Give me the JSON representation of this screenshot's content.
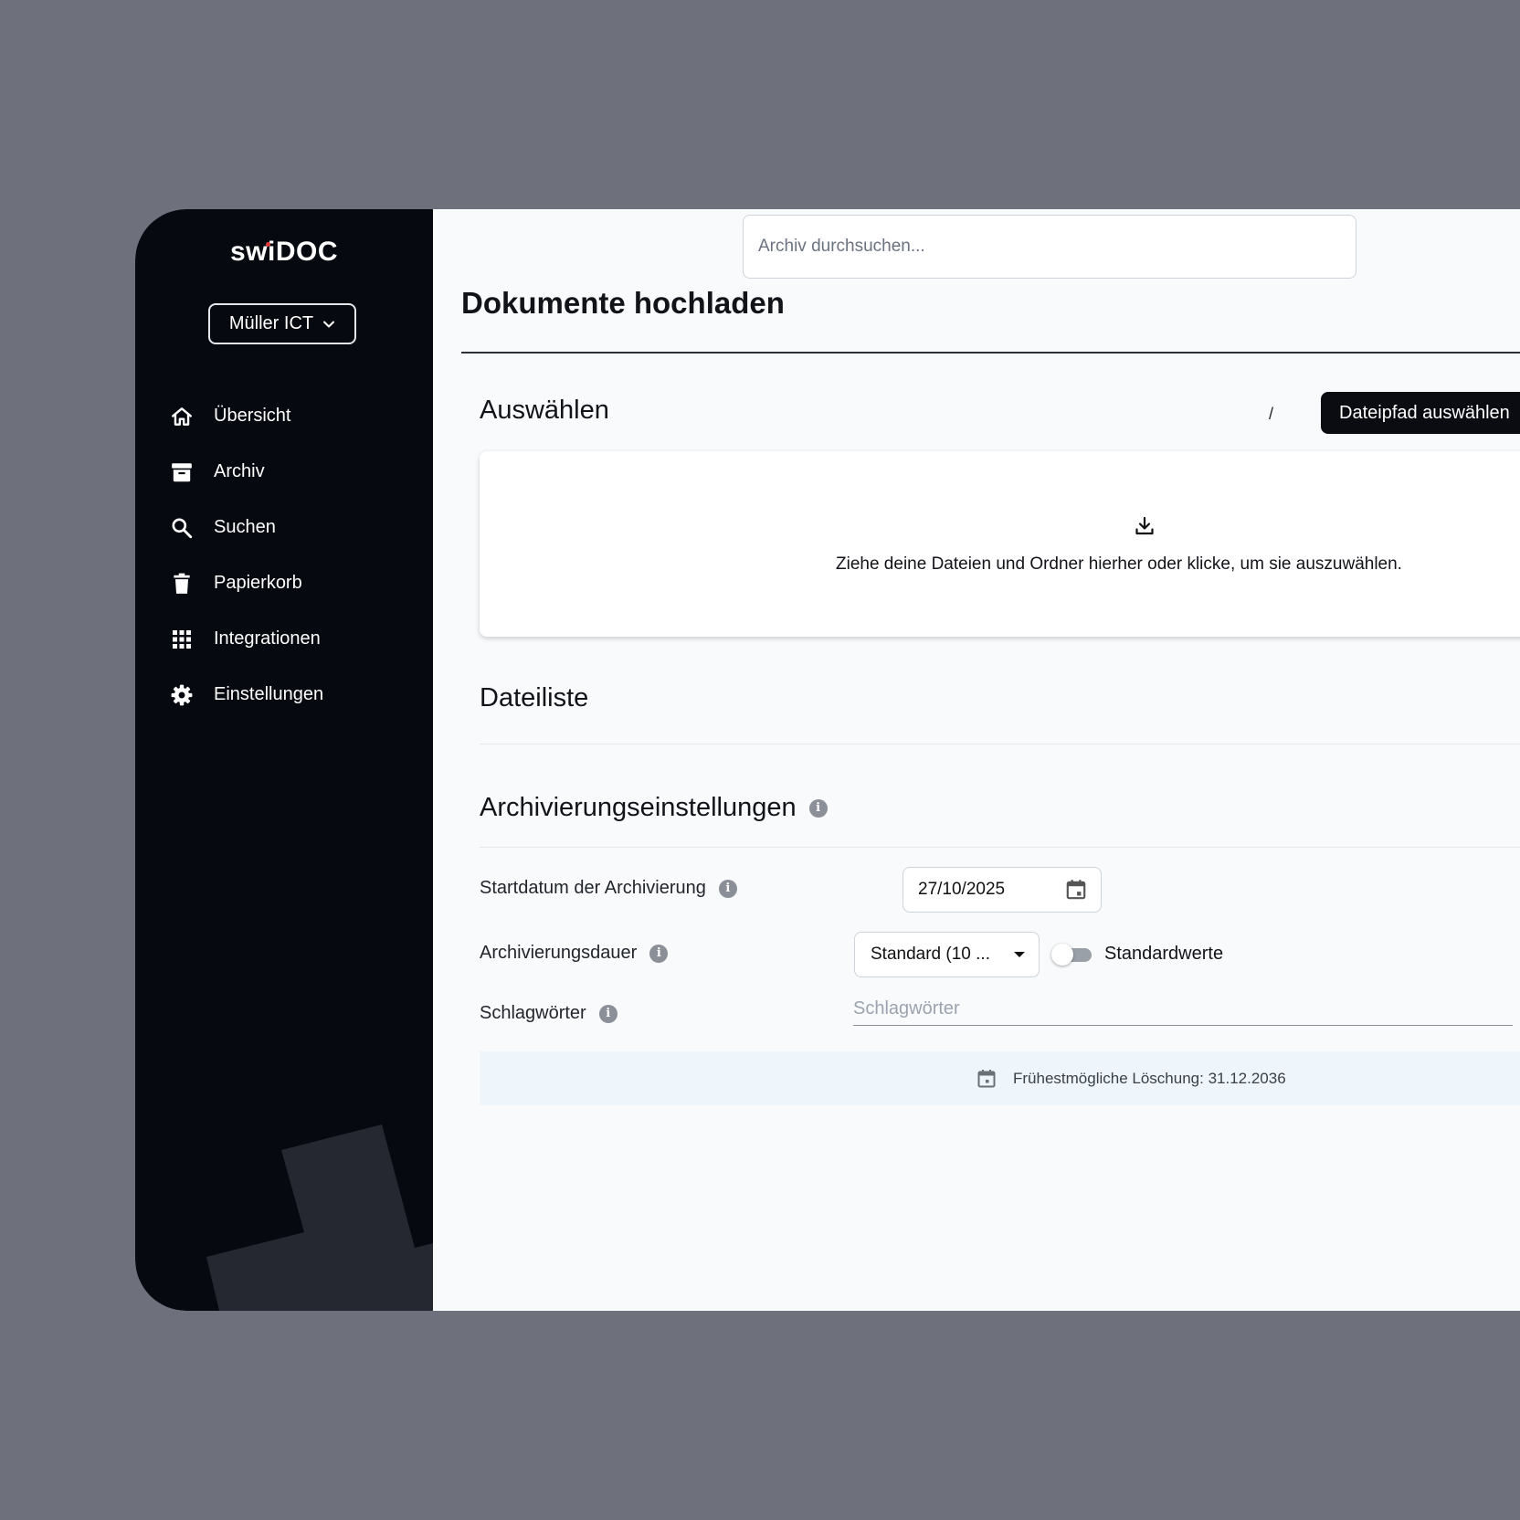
{
  "app": {
    "logo_text": "swiDOC",
    "tenant": "Müller ICT"
  },
  "sidebar": {
    "items": [
      {
        "label": "Übersicht",
        "icon": "home-icon"
      },
      {
        "label": "Archiv",
        "icon": "archive-icon"
      },
      {
        "label": "Suchen",
        "icon": "search-icon"
      },
      {
        "label": "Papierkorb",
        "icon": "trash-icon"
      },
      {
        "label": "Integrationen",
        "icon": "grid-icon"
      },
      {
        "label": "Einstellungen",
        "icon": "gear-icon"
      }
    ]
  },
  "header": {
    "search_placeholder": "Archiv durchsuchen..."
  },
  "page": {
    "title": "Dokumente hochladen"
  },
  "select_section": {
    "title": "Auswählen",
    "path_separator": "/",
    "path_button": "Dateipfad auswählen",
    "dropzone_text": "Ziehe deine Dateien und Ordner hierher oder klicke, um sie auszuwählen.",
    "dropzone_icon": "download-icon"
  },
  "file_list": {
    "title": "Dateiliste"
  },
  "archive_settings": {
    "title": "Archivierungseinstellungen",
    "start_date_label": "Startdatum der Archivierung",
    "start_date_value": "27/10/2025",
    "duration_label": "Archivierungsdauer",
    "duration_value": "Standard (10 ...",
    "toggle_label": "Standardwerte",
    "toggle_on": false,
    "keywords_label": "Schlagwörter",
    "keywords_placeholder": "Schlagwörter",
    "earliest_deletion": "Frühestmögliche Löschung: 31.12.2036"
  },
  "colors": {
    "sidebar_bg": "#070910",
    "backdrop": "#6e707c",
    "accent_dot": "#e53935",
    "info_box_bg": "#eef5fb"
  }
}
